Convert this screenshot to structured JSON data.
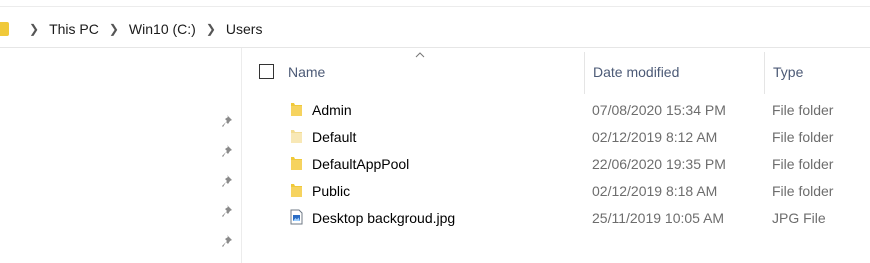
{
  "breadcrumb": [
    "This PC",
    "Win10 (C:)",
    "Users"
  ],
  "columns": {
    "name": "Name",
    "date_modified": "Date modified",
    "type": "Type"
  },
  "files": [
    {
      "name": "Admin",
      "date": "07/08/2020 15:34 PM",
      "type": "File folder",
      "icon": "folder-icon"
    },
    {
      "name": "Default",
      "date": "02/12/2019 8:12 AM",
      "type": "File folder",
      "icon": "folder-faded-icon"
    },
    {
      "name": "DefaultAppPool",
      "date": "22/06/2020 19:35 PM",
      "type": "File folder",
      "icon": "folder-icon"
    },
    {
      "name": "Public",
      "date": "02/12/2019 8:18 AM",
      "type": "File folder",
      "icon": "folder-icon"
    },
    {
      "name": "Desktop backgroud.jpg",
      "date": "25/11/2019 10:05 AM",
      "type": "JPG File",
      "icon": "image-file-icon"
    }
  ],
  "colors": {
    "folder": "#f0c93a",
    "folder_faded": "#f6e2a4",
    "header_text": "#4c5a76",
    "secondary_text": "#6d6d6d"
  }
}
